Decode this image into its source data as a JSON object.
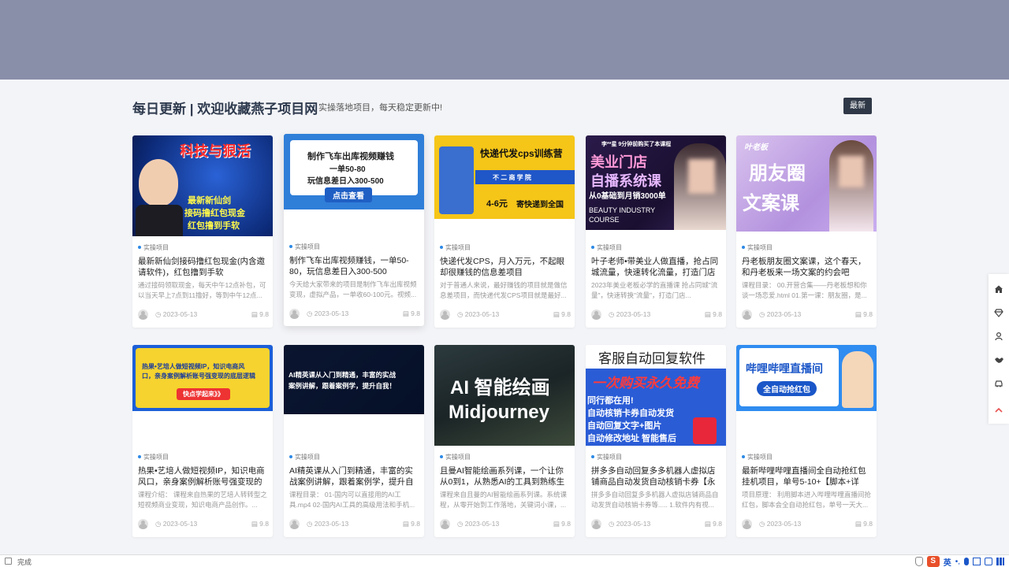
{
  "header": {
    "title": "每日更新 | 欢迎收藏燕子项目网",
    "subtitle": "实操落地项目，每天稳定更新中!",
    "latest_label": "最新"
  },
  "colors": {
    "banner": "#8a8fa9",
    "accent": "#2d8ae6",
    "button": "#2f3847"
  },
  "cards": [
    {
      "category": "实操项目",
      "title": "最新新仙剑接码撸红包现金(内含邀请软件)，红包撸到手软",
      "desc": "通过接码领取现金，每天中午12点补包，可以当天早上7点到11撸好，等到中午12点...",
      "date": "2023-05-13",
      "score": "9.8",
      "thumb": {
        "lines": [
          "科技与狠活",
          "最新新仙剑",
          "接码撸红包现金",
          "红包撸到手软"
        ]
      }
    },
    {
      "category": "实操项目",
      "title": "制作飞车出库视频赚钱，一单50-80，玩信息差日入300-500",
      "desc": "今天给大家带来的项目是制作飞车出库视频变现，虚拟产品，一单收60-100元。视频...",
      "date": "2023-05-13",
      "score": "9.8",
      "thumb": {
        "lines": [
          "制作飞车出库视频赚钱",
          "一单50-80",
          "玩信息差日入300-500",
          "点击查看"
        ]
      }
    },
    {
      "category": "实操项目",
      "title": "快递代发CPS，月入万元，不起眼却很赚钱的信息差项目",
      "desc": "对于普通人来说，最好赚钱的项目就是做信息差项目，而快递代发CPS项目就是最好...",
      "date": "2023-05-13",
      "score": "9.8",
      "thumb": {
        "lines": [
          "快递代发cps训练营",
          "不 二 商 学 院",
          "4-6元",
          "寄快递到全国"
        ]
      }
    },
    {
      "category": "实操项目",
      "title": "叶子老师•带美业人做直播，抢占同城流量，快速转化流量，打造门店盈...",
      "desc": "2023年美业老板必学的直播课 抢占同城\"流量\"，快速转换\"流量\"，打造门店...",
      "date": "2023-05-13",
      "score": "9.8",
      "thumb": {
        "lines": [
          "李**星 9分钟前购买了本课程",
          "美业门店",
          "自播系统课",
          "从0基础到月销3000单",
          "BEAUTY INDUSTRY",
          "COURSE"
        ]
      }
    },
    {
      "category": "实操项目",
      "title": "丹老板朋友圈文案课，这个春天，和丹老板来一场文案的约会吧",
      "desc": "课程目录： 00.开营合集——丹老板想和你谈一场恋爱.html 01.第一课：朋友圈，是...",
      "date": "2023-05-13",
      "score": "9.8",
      "thumb": {
        "lines": [
          "叶老板",
          "朋友圈",
          "文案课"
        ]
      }
    },
    {
      "category": "实操项目",
      "title": "热果•艺培人做短视频IP，知识电商风口，亲身案例解析账号强变现的底...",
      "desc": "课程介绍： 课程来自热果的艺培人转转型之短视频商业变现，知识电商产品创作。...",
      "date": "2023-05-13",
      "score": "9.8",
      "thumb": {
        "lines": [
          "热果•艺培人做短视频IP，知识电商风",
          "口，亲身案例解析账号强变现的底层逻辑",
          "快点学起来》》"
        ]
      }
    },
    {
      "category": "实操项目",
      "title": "AI精英课从入门到精通，丰富的实战案例讲解，跟着案例学，提升自我！",
      "desc": "课程目录： 01-国内可以直接用的AI工具.mp4 02-国内AI工具的高级用法和手机...",
      "date": "2023-05-13",
      "score": "9.8",
      "thumb": {
        "lines": [
          "AI精英课从入门到精通，丰富的实战",
          "案例讲解，跟着案例学，提升自我！"
        ]
      }
    },
    {
      "category": "实操项目",
      "title": "且曼AI智能绘画系列课，一个让你从0到1，从熟悉AI的工具到熟练生成...",
      "desc": "课程来自且曼的AI智能绘画系列课。系统课程，从零开始到工作落地，关键词小课，...",
      "date": "2023-05-13",
      "score": "9.8",
      "thumb": {
        "lines": [
          "AI 智能绘画",
          "Midjourney"
        ]
      }
    },
    {
      "category": "实操项目",
      "title": "拼多多自动回复多多机器人虚拟店铺商品自动发货自动核销卡券【永久...",
      "desc": "拼多多自动回复多多机器人虚拟店铺商品自动发货自动核销卡券等..... 1.软件内有视...",
      "date": "2023-05-13",
      "score": "9.8",
      "thumb": {
        "lines": [
          "客服自动回复软件",
          "一次购买永久免费",
          "同行都在用!",
          "自动核销卡券自动发货",
          "自动回复文字+图片",
          "自动修改地址 智能售后"
        ]
      }
    },
    {
      "category": "实操项目",
      "title": "最新哔哩哔哩直播间全自动抢红包挂机项目，单号5-10+【脚本+详细...",
      "desc": "项目原理： 利用脚本进入哔哩哔哩直播间抢红包，脚本会全自动抢红包，单号一天大...",
      "date": "2023-05-13",
      "score": "9.8",
      "thumb": {
        "lines": [
          "哔哩哔哩直播间",
          "全自动抢红包"
        ]
      }
    }
  ],
  "sidebar": {
    "items": [
      "home-icon",
      "diamond-icon",
      "user-icon",
      "handshake-icon",
      "car-icon",
      "arrow-up-icon"
    ]
  },
  "status": {
    "text": "完成",
    "ime_label": "英"
  }
}
